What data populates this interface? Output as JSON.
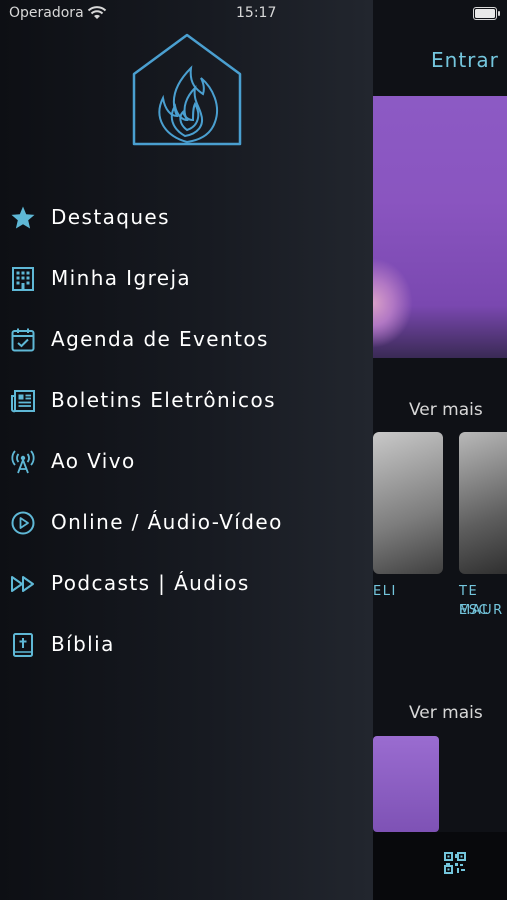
{
  "status_bar": {
    "carrier": "Operadora",
    "time": "15:17"
  },
  "header": {
    "login_label": "Entrar"
  },
  "sections": [
    {
      "more_label": "Ver mais"
    },
    {
      "more_label": "Ver mais"
    }
  ],
  "cards": [
    {
      "caption_line1": "ELI",
      "caption_line2": ""
    },
    {
      "caption_line1": "TE ESC",
      "caption_line2": "MAUR"
    }
  ],
  "drawer": {
    "logo_icon": "church-flame-logo",
    "accent_color": "#5fb8d6",
    "menu_items": [
      {
        "label": "Destaques",
        "icon": "star-icon"
      },
      {
        "label": "Minha Igreja",
        "icon": "building-icon"
      },
      {
        "label": "Agenda de Eventos",
        "icon": "calendar-icon"
      },
      {
        "label": "Boletins Eletrônicos",
        "icon": "newspaper-icon"
      },
      {
        "label": "Ao Vivo",
        "icon": "broadcast-icon"
      },
      {
        "label": "Online / Áudio-Vídeo",
        "icon": "play-circle-icon"
      },
      {
        "label": "Podcasts | Áudios",
        "icon": "fast-forward-icon"
      },
      {
        "label": "Bíblia",
        "icon": "bible-icon"
      }
    ]
  },
  "tab_bar": {
    "qr_icon": "qr-code-icon"
  }
}
